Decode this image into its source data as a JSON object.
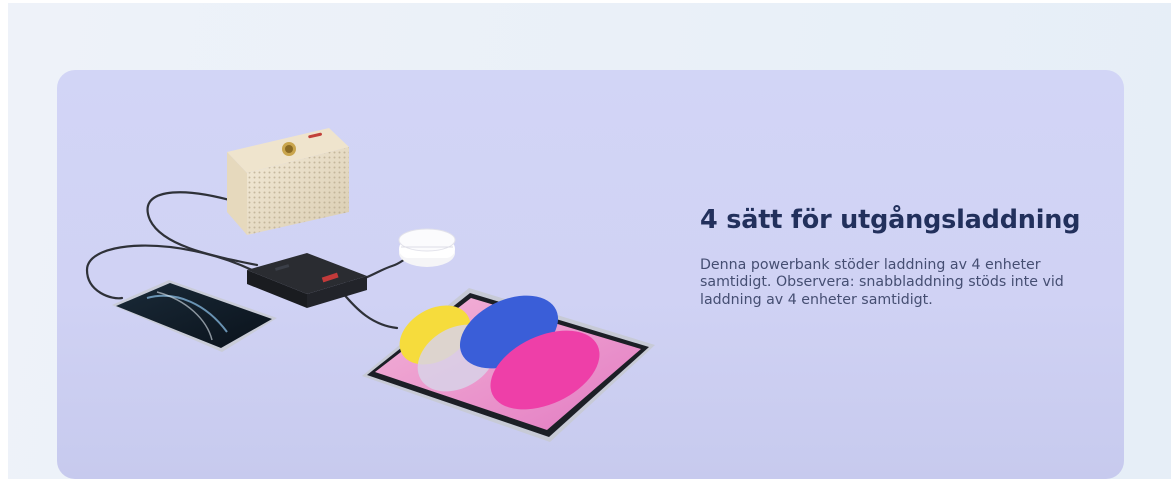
{
  "feature": {
    "headline": "4 sätt för utgångsladdning",
    "description": "Denna powerbank stöder laddning av 4 enheter samtidigt. Observera: snabbladdning stöds inte vid laddning av 4 enheter samtidigt."
  },
  "colors": {
    "card_background": "#d0d2f4",
    "headline": "#22305c",
    "body_text": "#454e72"
  },
  "illustration": {
    "devices": [
      "speaker-icon",
      "powerbank-icon",
      "earbuds-case-icon",
      "smartphone-icon",
      "tablet-icon"
    ]
  }
}
